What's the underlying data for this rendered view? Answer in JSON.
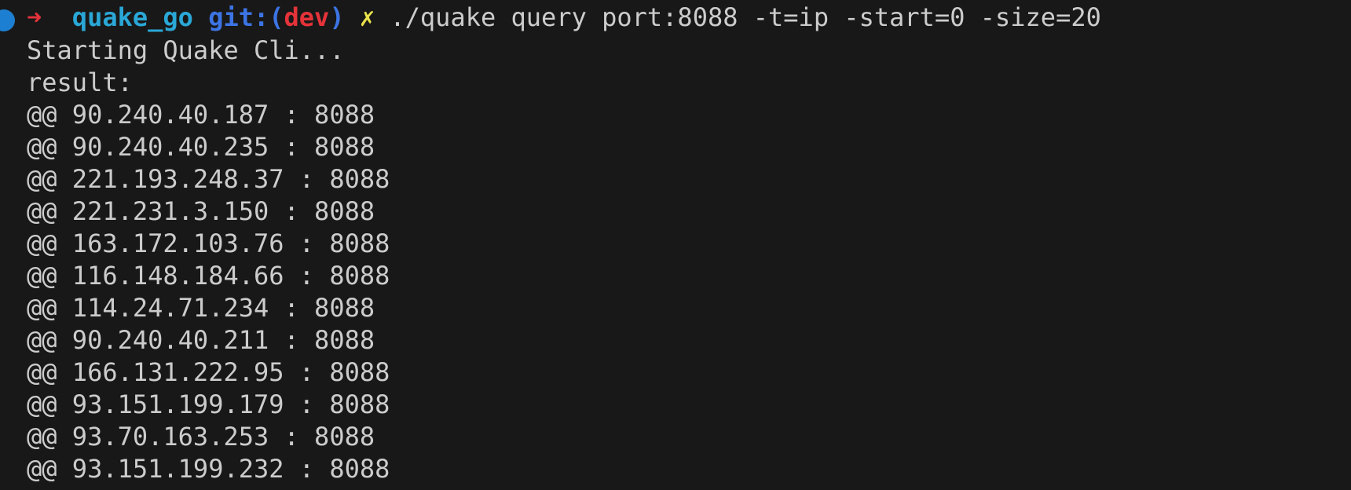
{
  "terminal": {
    "prompt": {
      "arrow": "➜",
      "directory": "quake_go",
      "git_label": "git:(",
      "branch": "dev",
      "git_close": ")",
      "dirty_marker": "✗",
      "command": "./quake query port:8088 -t=ip -start=0 -size=20"
    },
    "output": [
      "Starting Quake Cli...",
      "result:",
      "@@ 90.240.40.187 : 8088",
      "@@ 90.240.40.235 : 8088",
      "@@ 221.193.248.37 : 8088",
      "@@ 221.231.3.150 : 8088",
      "@@ 163.172.103.76 : 8088",
      "@@ 116.148.184.66 : 8088",
      "@@ 114.24.71.234 : 8088",
      "@@ 90.240.40.211 : 8088",
      "@@ 166.131.222.95 : 8088",
      "@@ 93.151.199.179 : 8088",
      "@@ 93.70.163.253 : 8088",
      "@@ 93.151.199.232 : 8088"
    ],
    "colors": {
      "background": "#181818",
      "text": "#cccccc",
      "arrow": "#e5333a",
      "directory": "#2aa7d6",
      "git": "#3c74e4",
      "dirty": "#ebe34a",
      "status_dot": "#1d7fd1"
    }
  }
}
